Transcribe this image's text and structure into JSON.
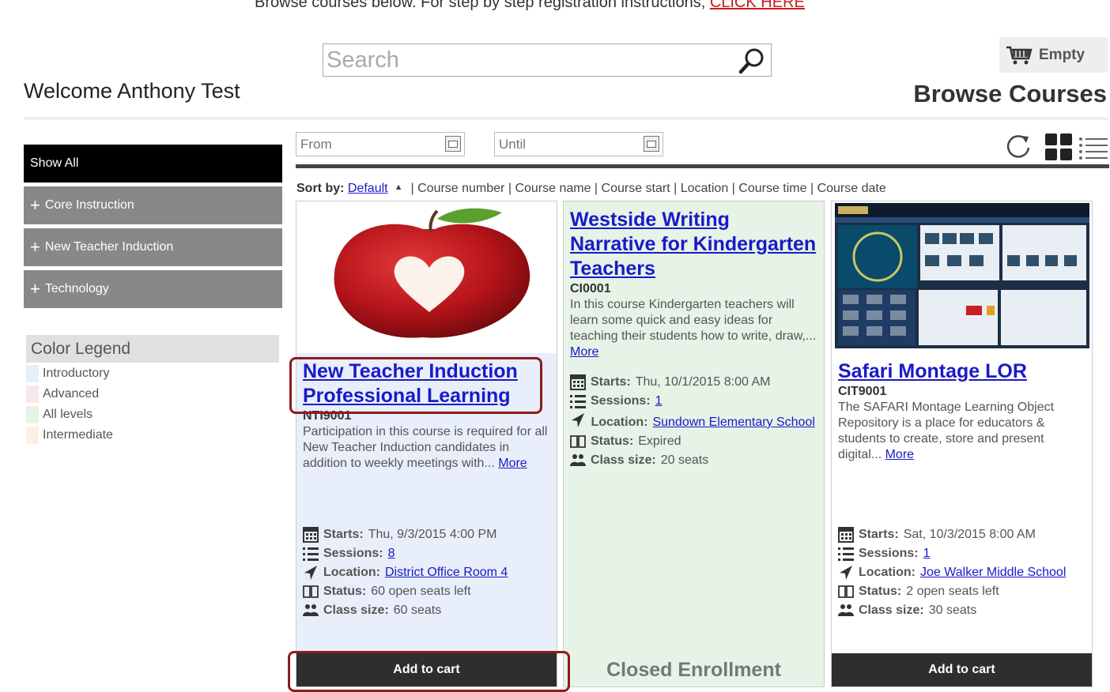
{
  "top_text": {
    "prefix": "Browse courses below. For step by step registration instructions, ",
    "link": "CLICK HERE"
  },
  "welcome": "Welcome Anthony Test",
  "search": {
    "placeholder": "Search"
  },
  "cart": {
    "label": "Empty"
  },
  "page_title": "Browse Courses",
  "sidebar": {
    "show_all": "Show All",
    "categories": [
      {
        "label": "Core Instruction"
      },
      {
        "label": "New Teacher Induction"
      },
      {
        "label": "Technology"
      }
    ]
  },
  "legend": {
    "title": "Color Legend",
    "items": [
      {
        "label": "Introductory",
        "color": "#e8eefa"
      },
      {
        "label": "Advanced",
        "color": "#fae8e8"
      },
      {
        "label": "All levels",
        "color": "#e6f3e6"
      },
      {
        "label": "Intermediate",
        "color": "#fcf0e0"
      }
    ]
  },
  "filters": {
    "from_placeholder": "From",
    "until_placeholder": "Until"
  },
  "sort": {
    "label": "Sort by:",
    "default": "Default",
    "options": [
      "Course number",
      "Course name",
      "Course start",
      "Location",
      "Course time",
      "Course date"
    ]
  },
  "labels": {
    "starts": "Starts:",
    "sessions": "Sessions:",
    "location": "Location:",
    "status": "Status:",
    "class_size": "Class size:",
    "more": "More"
  },
  "courses": [
    {
      "title": "New Teacher Induction Professional Learning",
      "code": "NTI9001",
      "description": "Participation in this course is required for all New Teacher Induction candidates in addition to weekly meetings with...",
      "starts": "Thu, 9/3/2015 4:00 PM",
      "sessions": "8",
      "location": "District Office Room 4",
      "status": "60 open seats left",
      "class_size": "60 seats",
      "action": "Add to cart",
      "level_color": "#e8eefa"
    },
    {
      "title": "Westside Writing Narrative for Kindergarten Teachers",
      "code": "CI0001",
      "description": "In this course Kindergarten teachers will learn some quick and easy ideas for teaching their students how to write, draw,...",
      "starts": "Thu, 10/1/2015 8:00 AM",
      "sessions": "1",
      "location": "Sundown Elementary School",
      "status": "Expired",
      "class_size": "20 seats",
      "action": "Closed Enrollment",
      "level_color": "#e6f3e6"
    },
    {
      "title": "Safari Montage LOR",
      "code": "CIT9001",
      "description": "The SAFARI Montage Learning Object Repository is a place for educators & students to create, store and present digital...",
      "starts": "Sat, 10/3/2015 8:00 AM",
      "sessions": "1",
      "location": "Joe Walker Middle School",
      "status": "2 open seats left",
      "class_size": "30 seats",
      "action": "Add to cart",
      "level_color": "#ffffff"
    }
  ]
}
